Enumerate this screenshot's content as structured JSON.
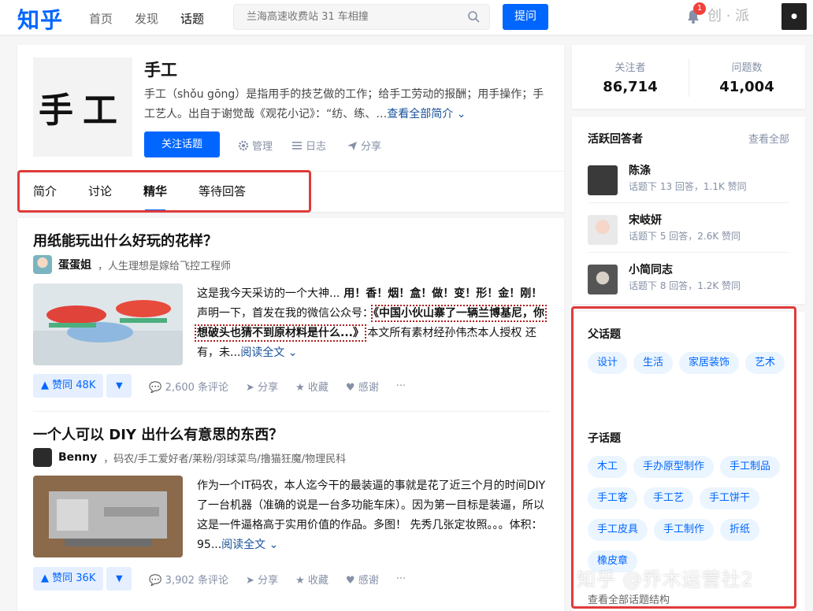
{
  "header": {
    "logo": "知乎",
    "nav": [
      "首页",
      "发现",
      "话题"
    ],
    "search_placeholder": "兰海高速收费站 31 车相撞",
    "ask_label": "提问",
    "notification_count": "1",
    "watermark_top": "创 · 派"
  },
  "topic": {
    "image_text": "手工",
    "title": "手工",
    "description": "手工（shǒu gōng）是指用手的技艺做的工作；给手工劳动的报酬；用手操作；手工艺人。出自于谢觉哉《观花小记》：“纺、练、…",
    "more_label": "查看全部简介",
    "follow_label": "关注话题",
    "manage_label": "管理",
    "log_label": "日志",
    "share_label": "分享",
    "tabs": [
      "简介",
      "讨论",
      "精华",
      "等待回答"
    ]
  },
  "feed": [
    {
      "title": "用纸能玩出什么好玩的花样？",
      "author": "蛋蛋姐",
      "bio": "，人生理想是嫁给飞控工程师",
      "excerpt_a": "这是我今天采访的一个大神...",
      "excerpt_bold": " 用！香！烟！盒！做！变！形！金！刚！",
      "excerpt_b": " 声明一下，首发在我的微信公众号：",
      "excerpt_dotted": "《中国小伙山寨了一辆兰博基尼，你想破头也猜不到原材料是什么...》",
      "excerpt_c": " 本文所有素材经孙伟杰本人授权 还有，未...",
      "more_label": "阅读全文",
      "votes": "赞同 48K",
      "comments": "2,600 条评论",
      "share": "分享",
      "collect": "收藏",
      "thanks": "感谢"
    },
    {
      "title": "一个人可以 DIY 出什么有意思的东西？",
      "author": "Benny",
      "bio": "，码农/手工爱好者/莱粉/羽球菜鸟/撸猫狂魔/物理民科",
      "excerpt_a": "作为一个IT码农，本人迄今干的最装逼的事就是花了近三个月的时间DIY了一台机器（准确的说是一台多功能车床）。因为第一目标是装逼，所以这是一件逼格高于实用价值的作品。多图！ 先秀几张定妆照。。。体积：95...",
      "more_label": "阅读全文",
      "votes": "赞同 36K",
      "comments": "3,902 条评论",
      "share": "分享",
      "collect": "收藏",
      "thanks": "感谢"
    }
  ],
  "stats": {
    "followers_label": "关注者",
    "followers": "86,714",
    "questions_label": "问题数",
    "questions": "41,004"
  },
  "answerers": {
    "title": "活跃回答者",
    "see_all": "查看全部",
    "items": [
      {
        "name": "陈涤",
        "info": "话题下 13 回答，1.1K 赞同"
      },
      {
        "name": "宋岐妍",
        "info": "话题下 5 回答，2.6K 赞同"
      },
      {
        "name": "小简同志",
        "info": "话题下 8 回答，1.2K 赞同"
      }
    ]
  },
  "topics": {
    "parent_title": "父话题",
    "parents": [
      "设计",
      "生活",
      "家居装饰",
      "艺术"
    ],
    "child_title": "子话题",
    "children": [
      "木工",
      "手办原型制作",
      "手工制品",
      "手工客",
      "手工艺",
      "手工饼干",
      "手工皮具",
      "手工制作",
      "折纸",
      "橡皮章"
    ],
    "structure_link": "查看全部话题结构"
  },
  "watermark": "知乎 @乔木运营社2",
  "colors": {
    "brand": "#0066ff",
    "highlight_border": "#e03a3a"
  }
}
